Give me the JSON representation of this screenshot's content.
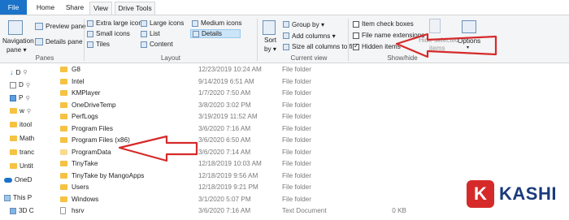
{
  "tabs": {
    "file": "File",
    "home": "Home",
    "share": "Share",
    "view": "View",
    "drive_tools": "Drive Tools"
  },
  "ribbon": {
    "panes": {
      "navigation_pane": "Navigation",
      "navigation_pane_2": "pane ▾",
      "preview_pane": "Preview pane",
      "details_pane": "Details pane",
      "label": "Panes"
    },
    "layout": {
      "extra_large_icons": "Extra large icons",
      "large_icons": "Large icons",
      "medium_icons": "Medium icons",
      "small_icons": "Small icons",
      "list": "List",
      "details": "Details",
      "tiles": "Tiles",
      "content": "Content",
      "label": "Layout"
    },
    "current_view": {
      "sort_by": "Sort",
      "sort_by_2": "by ▾",
      "group_by": "Group by ▾",
      "add_columns": "Add columns ▾",
      "size_all_columns": "Size all columns to fit",
      "label": "Current view"
    },
    "show_hide": {
      "item_check_boxes": "Item check boxes",
      "file_name_extensions": "File name extensions",
      "hidden_items": "Hidden items",
      "hide_selected_1": "Hide selected",
      "hide_selected_2": "items",
      "options": "Options",
      "label": "Show/hide",
      "item_check_boxes_checked": false,
      "file_name_extensions_checked": false,
      "hidden_items_checked": true
    }
  },
  "nav": {
    "items": [
      {
        "label": "D",
        "icon": "download-icon"
      },
      {
        "label": "D",
        "icon": "document-icon"
      },
      {
        "label": "P",
        "icon": "picture-icon"
      },
      {
        "label": "w",
        "icon": "folder-icon"
      },
      {
        "label": "itool",
        "icon": "folder-icon"
      },
      {
        "label": "Math",
        "icon": "folder-icon"
      },
      {
        "label": "tranc",
        "icon": "folder-icon"
      },
      {
        "label": "Untit",
        "icon": "folder-icon"
      },
      {
        "label": "OneD",
        "icon": "onedrive-icon"
      },
      {
        "label": "This P",
        "icon": "computer-icon"
      },
      {
        "label": "3D C",
        "icon": "3d-objects-icon"
      }
    ]
  },
  "files": [
    {
      "name": "G8",
      "date": "12/23/2019 10:24 AM",
      "type": "File folder",
      "size": "",
      "kind": "folder"
    },
    {
      "name": "Intel",
      "date": "9/14/2019 6:51 AM",
      "type": "File folder",
      "size": "",
      "kind": "folder"
    },
    {
      "name": "KMPlayer",
      "date": "1/7/2020 7:50 AM",
      "type": "File folder",
      "size": "",
      "kind": "folder"
    },
    {
      "name": "OneDriveTemp",
      "date": "3/8/2020 3:02 PM",
      "type": "File folder",
      "size": "",
      "kind": "folder"
    },
    {
      "name": "PerfLogs",
      "date": "3/19/2019 11:52 AM",
      "type": "File folder",
      "size": "",
      "kind": "folder"
    },
    {
      "name": "Program Files",
      "date": "3/6/2020 7:16 AM",
      "type": "File folder",
      "size": "",
      "kind": "folder"
    },
    {
      "name": "Program Files (x86)",
      "date": "3/6/2020 6:50 AM",
      "type": "File folder",
      "size": "",
      "kind": "folder"
    },
    {
      "name": "ProgramData",
      "date": "3/6/2020 7:14 AM",
      "type": "File folder",
      "size": "",
      "kind": "folder"
    },
    {
      "name": "TinyTake",
      "date": "12/18/2019 10:03 AM",
      "type": "File folder",
      "size": "",
      "kind": "folder"
    },
    {
      "name": "TinyTake by MangoApps",
      "date": "12/18/2019 9:56 AM",
      "type": "File folder",
      "size": "",
      "kind": "folder"
    },
    {
      "name": "Users",
      "date": "12/18/2019 9:21 PM",
      "type": "File folder",
      "size": "",
      "kind": "folder"
    },
    {
      "name": "Windows",
      "date": "3/1/2020 5:07 PM",
      "type": "File folder",
      "size": "",
      "kind": "folder"
    },
    {
      "name": "hsrv",
      "date": "3/6/2020 7:16 AM",
      "type": "Text Document",
      "size": "0 KB",
      "kind": "text"
    }
  ],
  "watermark": {
    "letter": "K",
    "text": "KASHI"
  },
  "colors": {
    "file_tab": "#1a73c9",
    "ribbon_bg": "#f4f5f7",
    "folder": "#f5c242",
    "arrow": "#d62a2a",
    "logo_red": "#d62a2a",
    "logo_blue": "#1a3a7a"
  }
}
